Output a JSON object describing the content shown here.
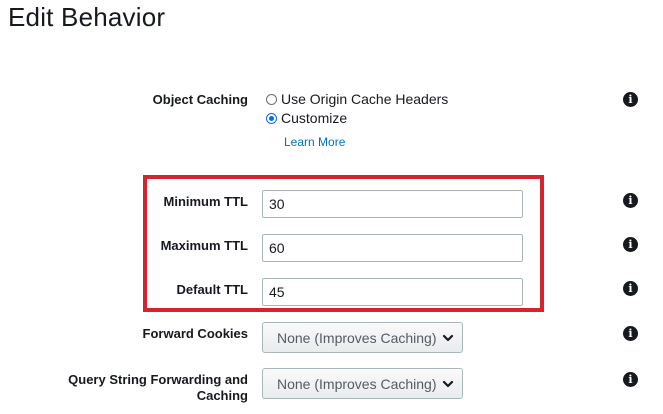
{
  "page": {
    "title": "Edit Behavior"
  },
  "object_caching": {
    "label": "Object Caching",
    "options": [
      {
        "label": "Use Origin Cache Headers",
        "checked": false
      },
      {
        "label": "Customize",
        "checked": true
      }
    ],
    "link": "Learn More"
  },
  "ttl": {
    "minimum": {
      "label": "Minimum TTL",
      "value": "30"
    },
    "maximum": {
      "label": "Maximum TTL",
      "value": "60"
    },
    "default": {
      "label": "Default TTL",
      "value": "45"
    }
  },
  "forward_cookies": {
    "label": "Forward Cookies",
    "selected": "None (Improves Caching)"
  },
  "query_string": {
    "label": "Query String Forwarding and Caching",
    "selected": "None (Improves Caching)"
  },
  "info_glyph": "i",
  "icons": {
    "info": "info-circle-icon",
    "dropdown": "chevron-down-icon"
  },
  "colors": {
    "highlight": "#d6242d",
    "link": "#0073bb",
    "radio_checked": "#0a6cdf"
  }
}
